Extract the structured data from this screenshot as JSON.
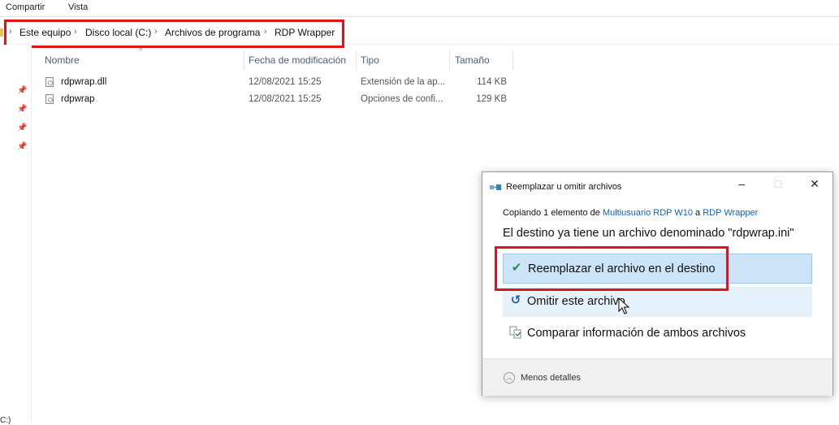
{
  "ribbon": {
    "tabs": [
      "Compartir",
      "Vista"
    ]
  },
  "breadcrumb": [
    "Este equipo",
    "Disco local (C:)",
    "Archivos de programa",
    "RDP Wrapper"
  ],
  "columns": {
    "name": "Nombre",
    "modified": "Fecha de modificación",
    "type": "Tipo",
    "size": "Tamaño"
  },
  "files": [
    {
      "name": "rdpwrap.dll",
      "modified": "12/08/2021 15:25",
      "type": "Extensión de la ap...",
      "size": "114 KB"
    },
    {
      "name": "rdpwrap",
      "modified": "12/08/2021 15:25",
      "type": "Opciones de confi...",
      "size": "129 KB"
    }
  ],
  "dialog": {
    "title": "Reemplazar u omitir archivos",
    "copy_prefix": "Copiando 1 elemento de ",
    "copy_source": "Multiusuario RDP W10",
    "copy_middle": " a ",
    "copy_dest": "RDP Wrapper",
    "destination_message": "El destino ya tiene un archivo denominado \"rdpwrap.ini\"",
    "options": [
      {
        "label": "Reemplazar el archivo en el destino",
        "icon": "checkmark-icon"
      },
      {
        "label": "Omitir este archivo",
        "icon": "skip-arrow-icon"
      },
      {
        "label": "Comparar información de ambos archivos",
        "icon": "compare-files-icon"
      }
    ],
    "footer_label": "Menos detalles"
  },
  "sidebar_stub_text": "C:)",
  "colors": {
    "highlight_box": "#e0131d",
    "link": "#0b63c4",
    "selected_option_bg": "#cce4f7",
    "hover_option_bg": "#e5f1fb",
    "checkmark": "#1e8e3e",
    "skip_icon": "#1f5fb4"
  }
}
